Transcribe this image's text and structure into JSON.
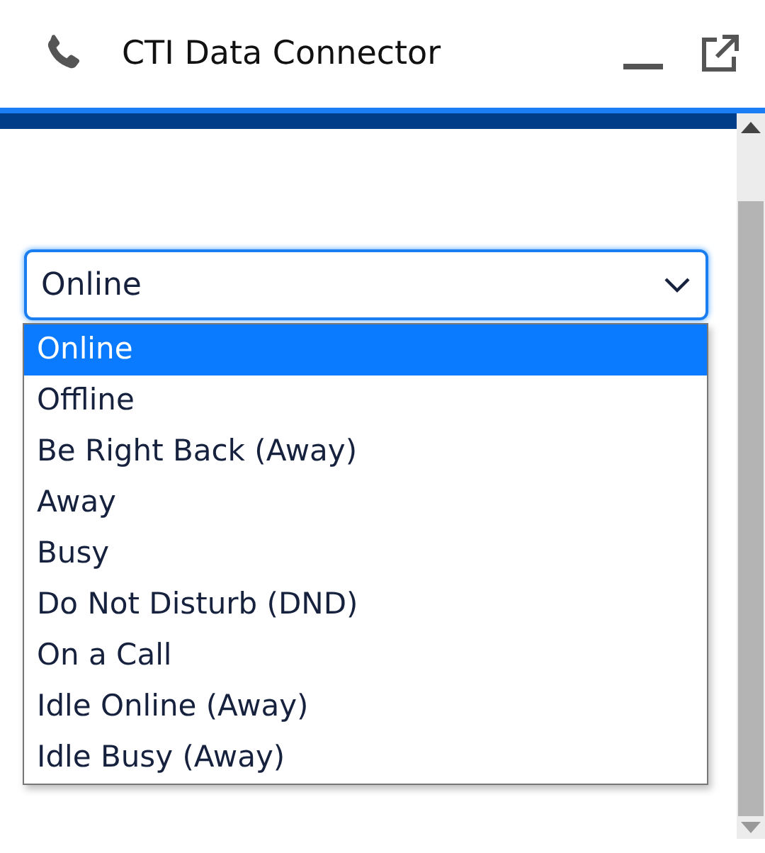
{
  "window": {
    "title": "CTI Data Connector"
  },
  "status_select": {
    "value": "Online",
    "expanded": true
  },
  "options": [
    {
      "label": "Online",
      "selected": true
    },
    {
      "label": "Offline",
      "selected": false
    },
    {
      "label": "Be Right Back (Away)",
      "selected": false
    },
    {
      "label": "Away",
      "selected": false
    },
    {
      "label": "Busy",
      "selected": false
    },
    {
      "label": "Do Not Disturb (DND)",
      "selected": false
    },
    {
      "label": "On a Call",
      "selected": false
    },
    {
      "label": "Idle Online (Away)",
      "selected": false
    },
    {
      "label": "Idle Busy (Away)",
      "selected": false
    }
  ]
}
